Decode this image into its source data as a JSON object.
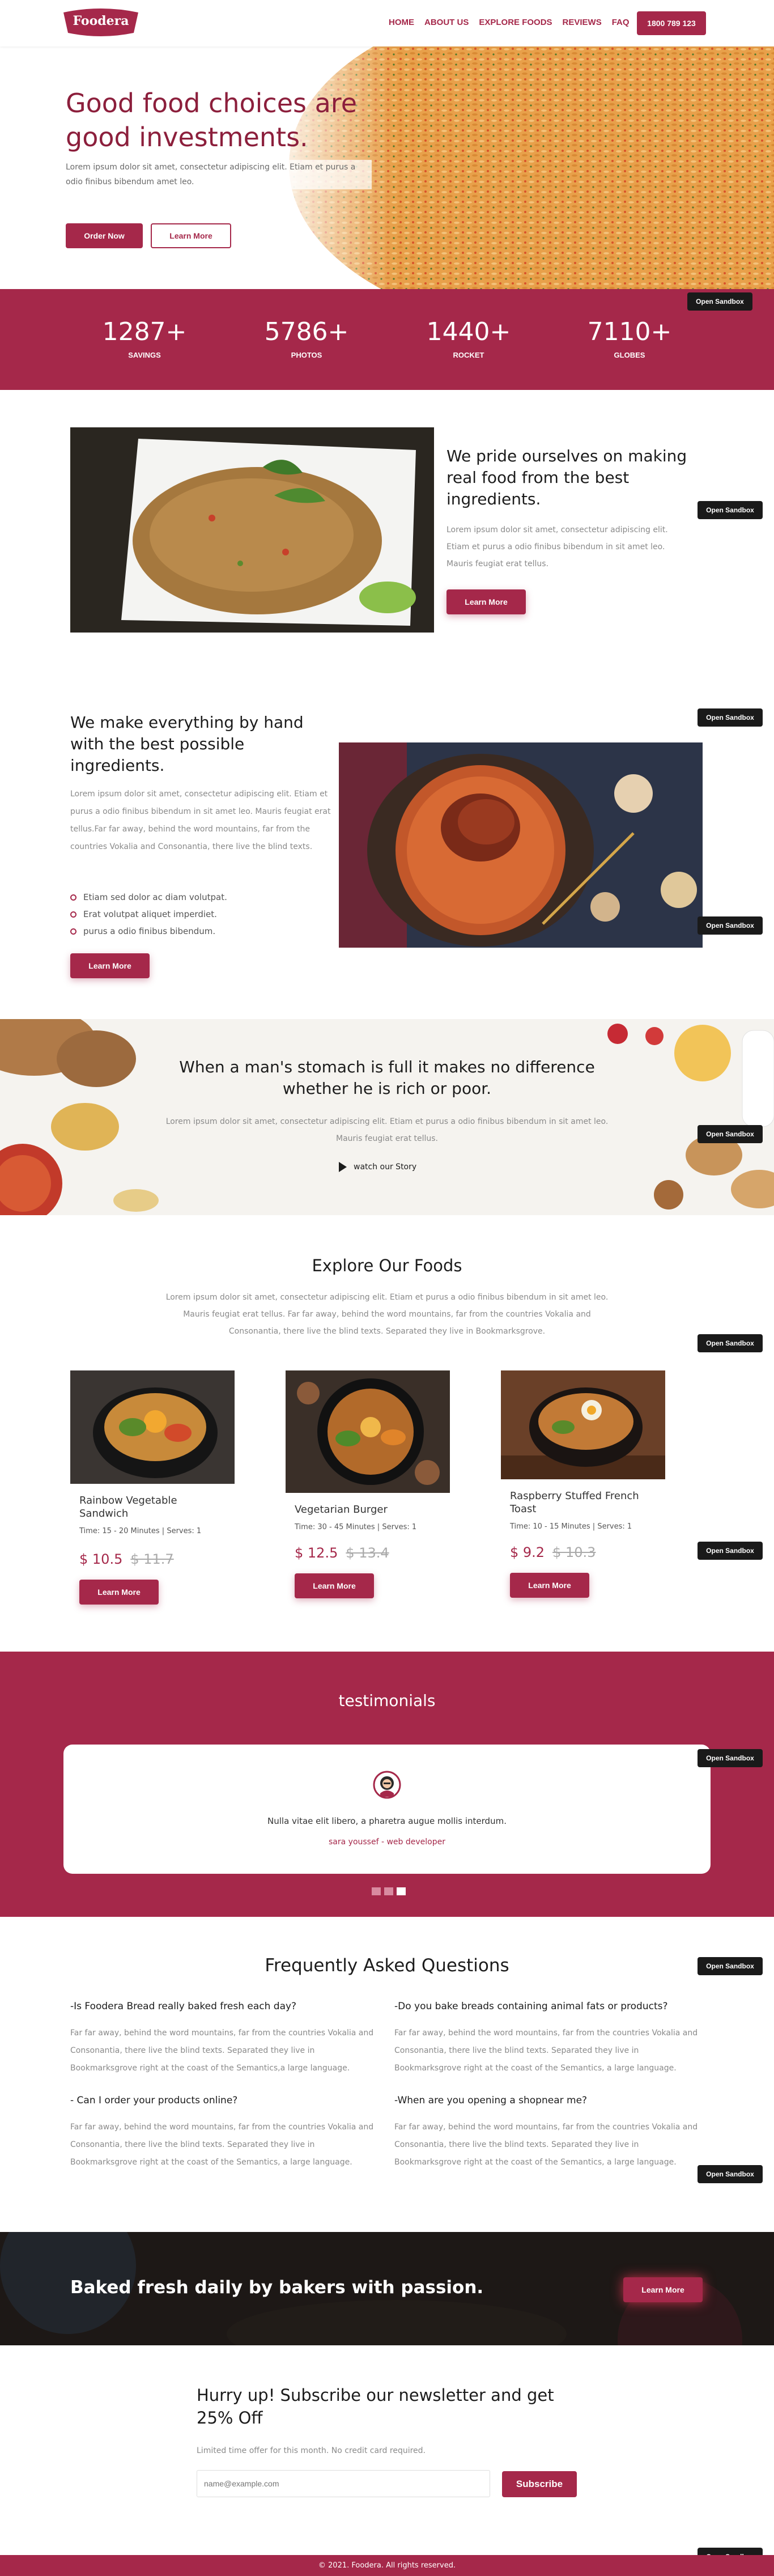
{
  "brand": {
    "logo": "Foodera"
  },
  "nav": {
    "items": [
      "HOME",
      "ABOUT US",
      "EXPLORE FOODS",
      "REVIEWS",
      "FAQ"
    ],
    "phone": "1800 789 123"
  },
  "hero": {
    "title": "Good food choices are good investments.",
    "text": "Lorem ipsum dolor sit amet, consectetur adipiscing elit. Etiam et purus a odio finibus bibendum amet leo.",
    "order_btn": "Order Now",
    "learn_btn": "Learn More"
  },
  "stats": [
    {
      "value": "1287+",
      "label": "SAVINGS"
    },
    {
      "value": "5786+",
      "label": "PHOTOS"
    },
    {
      "value": "1440+",
      "label": "ROCKET"
    },
    {
      "value": "7110+",
      "label": "GLOBES"
    }
  ],
  "sandbox_label": "Open Sandbox",
  "pride": {
    "title": "We pride ourselves on making real food from the best ingredients.",
    "text": "Lorem ipsum dolor sit amet, consectetur adipiscing elit. Etiam et purus a odio finibus bibendum in sit amet leo. Mauris feugiat erat tellus.",
    "btn": "Learn More"
  },
  "hand": {
    "title": "We make everything by hand with the best possible ingredients.",
    "text": "Lorem ipsum dolor sit amet, consectetur adipiscing elit. Etiam et purus a odio finibus bibendum in sit amet leo. Mauris feugiat erat tellus.Far far away, behind the word mountains, far from the countries Vokalia and Consonantia, there live the blind texts.",
    "bullets": [
      "Etiam sed dolor ac diam volutpat.",
      "Erat volutpat aliquet imperdiet.",
      "purus a odio finibus bibendum."
    ],
    "btn": "Learn More"
  },
  "quote": {
    "title": "When a man's stomach is full it makes no difference whether he is rich or poor.",
    "text": "Lorem ipsum dolor sit amet, consectetur adipiscing elit. Etiam et purus a odio finibus bibendum in sit amet leo. Mauris feugiat erat tellus.",
    "watch": "watch our Story"
  },
  "explore": {
    "title": "Explore Our Foods",
    "text": "Lorem ipsum dolor sit amet, consectetur adipiscing elit. Etiam et purus a odio finibus bibendum in sit amet leo. Mauris feugiat erat tellus. Far far away, behind the word mountains, far from the countries Vokalia and Consonantia, there live the blind texts. Separated they live in Bookmarksgrove.",
    "items": [
      {
        "name": "Rainbow Vegetable Sandwich",
        "time": "Time: 15 - 20 Minutes | Serves: 1",
        "price": "$ 10.5",
        "old": "$ 11.7",
        "btn": "Learn More"
      },
      {
        "name": "Vegetarian Burger",
        "time": "Time: 30 - 45 Minutes | Serves: 1",
        "price": "$ 12.5",
        "old": "$ 13.4",
        "btn": "Learn More"
      },
      {
        "name": "Raspberry Stuffed French Toast",
        "time": "Time: 10 - 15 Minutes | Serves: 1",
        "price": "$ 9.2",
        "old": "$ 10.3",
        "btn": "Learn More"
      }
    ]
  },
  "testimonials": {
    "title": "testimonials",
    "quote": "Nulla vitae elit libero, a pharetra augue mollis interdum.",
    "author": "sara youssef - web developer"
  },
  "faq": {
    "title": "Frequently Asked Questions",
    "items": [
      {
        "q": "-Is Foodera Bread really baked fresh each day?",
        "a": "Far far away, behind the word mountains, far from the countries Vokalia and Consonantia, there live the blind texts. Separated they live in Bookmarksgrove right at the coast of the Semantics,a large language."
      },
      {
        "q": "-Do you bake breads containing animal fats or products?",
        "a": "Far far away, behind the word mountains, far from the countries Vokalia and Consonantia, there live the blind texts. Separated they live in Bookmarksgrove right at the coast of the Semantics, a large language."
      },
      {
        "q": "- Can I order your products online?",
        "a": "Far far away, behind the word mountains, far from the countries Vokalia and Consonantia, there live the blind texts. Separated they live in Bookmarksgrove right at the coast of the Semantics, a large language."
      },
      {
        "q": "-When are you opening a shopnear me?",
        "a": "Far far away, behind the word mountains, far from the countries Vokalia and Consonantia, there live the blind texts. Separated they live in Bookmarksgrove right at the coast of the Semantics, a large language."
      }
    ]
  },
  "banner": {
    "title": "Baked fresh daily by bakers with passion.",
    "btn": "Learn More"
  },
  "newsletter": {
    "title": "Hurry up! Subscribe our newsletter and get 25% Off",
    "text": "Limited time offer for this month. No credit card required.",
    "placeholder": "name@example.com",
    "btn": "Subscribe"
  },
  "footer": {
    "copyright": "© 2021. Foodera. All rights reserved."
  },
  "colors": {
    "accent": "#a5284a",
    "dark": "#1a1a1a"
  }
}
